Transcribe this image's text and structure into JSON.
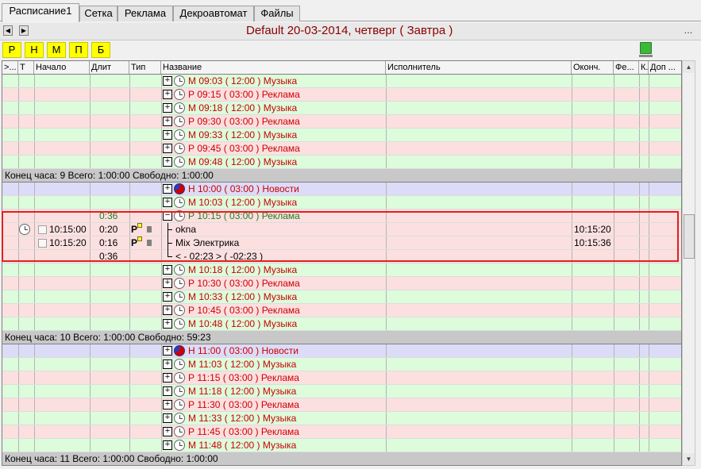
{
  "tabs": [
    "Расписание1",
    "Сетка",
    "Реклама",
    "Декроавтомат",
    "Файлы"
  ],
  "day_title": "Default 20-03-2014, четверг ( Завтра )",
  "more_label": "...",
  "nav": {
    "prev_icon": "play-back-icon",
    "next_icon": "play-forward-icon"
  },
  "filters": [
    "Р",
    "Н",
    "М",
    "П",
    "Б"
  ],
  "columns": [
    ">...",
    "Т",
    "Начало",
    "Длит",
    "Тип",
    "Название",
    "Исполнитель",
    "Оконч.",
    "Фе...",
    "К..",
    "Доп ..."
  ],
  "rows": [
    {
      "kind": "item",
      "color": "green",
      "icon": "clock",
      "text": "М 09:03 ( 12:00 ) Музыка",
      "tone": "red"
    },
    {
      "kind": "item",
      "color": "pink",
      "icon": "clock",
      "text": "Р 09:15 ( 03:00 ) Реклама",
      "tone": "red"
    },
    {
      "kind": "item",
      "color": "green",
      "icon": "clock",
      "text": "М 09:18 ( 12:00 ) Музыка",
      "tone": "red"
    },
    {
      "kind": "item",
      "color": "pink",
      "icon": "clock",
      "text": "Р 09:30 ( 03:00 ) Реклама",
      "tone": "red"
    },
    {
      "kind": "item",
      "color": "green",
      "icon": "clock",
      "text": "М 09:33 ( 12:00 ) Музыка",
      "tone": "red"
    },
    {
      "kind": "item",
      "color": "pink",
      "icon": "clock",
      "text": "Р 09:45 ( 03:00 ) Реклама",
      "tone": "red"
    },
    {
      "kind": "item",
      "color": "green",
      "icon": "clock",
      "text": "М 09:48 ( 12:00 ) Музыка",
      "tone": "red"
    },
    {
      "kind": "hourend",
      "text": "Конец часа: 9 Всего: 1:00:00 Свободно:  1:00:00"
    },
    {
      "kind": "item",
      "color": "lav",
      "icon": "news",
      "text": "Н 10:00 ( 03:00 ) Новости",
      "tone": "red"
    },
    {
      "kind": "item",
      "color": "green",
      "icon": "clock",
      "text": "М 10:03 ( 12:00 ) Музыка",
      "tone": "red"
    },
    {
      "kind": "item",
      "color": "sel",
      "icon": "clock-minus",
      "text": "Р 10:15 ( 03:00 ) Реклама",
      "tone": "green",
      "dur": "0:36",
      "dur_tone": "green"
    },
    {
      "kind": "sub",
      "color": "sel",
      "text": "okna",
      "start": "10:15:00",
      "dur": "0:20",
      "end": "10:15:20",
      "clock": true
    },
    {
      "kind": "sub",
      "color": "sel",
      "text": "Mix Электрика",
      "start": "10:15:20",
      "dur": "0:16",
      "end": "10:15:36"
    },
    {
      "kind": "sub",
      "color": "sel",
      "text": "< - 02:23 > ( -02:23 )",
      "dur": "0:36",
      "last": true
    },
    {
      "kind": "item",
      "color": "green",
      "icon": "clock",
      "text": "М 10:18 ( 12:00 ) Музыка",
      "tone": "red"
    },
    {
      "kind": "item",
      "color": "pink",
      "icon": "clock",
      "text": "Р 10:30 ( 03:00 ) Реклама",
      "tone": "red"
    },
    {
      "kind": "item",
      "color": "green",
      "icon": "clock",
      "text": "М 10:33 ( 12:00 ) Музыка",
      "tone": "red"
    },
    {
      "kind": "item",
      "color": "pink",
      "icon": "clock",
      "text": "Р 10:45 ( 03:00 ) Реклама",
      "tone": "red"
    },
    {
      "kind": "item",
      "color": "green",
      "icon": "clock",
      "text": "М 10:48 ( 12:00 ) Музыка",
      "tone": "red"
    },
    {
      "kind": "hourend",
      "text": "Конец часа: 10 Всего: 1:00:00 Свободно: 59:23"
    },
    {
      "kind": "item",
      "color": "lav",
      "icon": "news",
      "text": "Н 11:00 ( 03:00 ) Новости",
      "tone": "red"
    },
    {
      "kind": "item",
      "color": "green",
      "icon": "clock",
      "text": "М 11:03 ( 12:00 ) Музыка",
      "tone": "red"
    },
    {
      "kind": "item",
      "color": "pink",
      "icon": "clock",
      "text": "Р 11:15 ( 03:00 ) Реклама",
      "tone": "red"
    },
    {
      "kind": "item",
      "color": "green",
      "icon": "clock",
      "text": "М 11:18 ( 12:00 ) Музыка",
      "tone": "red"
    },
    {
      "kind": "item",
      "color": "pink",
      "icon": "clock",
      "text": "Р 11:30 ( 03:00 ) Реклама",
      "tone": "red"
    },
    {
      "kind": "item",
      "color": "green",
      "icon": "clock",
      "text": "М 11:33 ( 12:00 ) Музыка",
      "tone": "red"
    },
    {
      "kind": "item",
      "color": "pink",
      "icon": "clock",
      "text": "Р 11:45 ( 03:00 ) Реклама",
      "tone": "red"
    },
    {
      "kind": "item",
      "color": "green",
      "icon": "clock",
      "text": "М 11:48 ( 12:00 ) Музыка",
      "tone": "red"
    },
    {
      "kind": "hourend",
      "text": "Конец часа: 11 Всего: 1:00:00 Свободно:  1:00:00"
    }
  ]
}
